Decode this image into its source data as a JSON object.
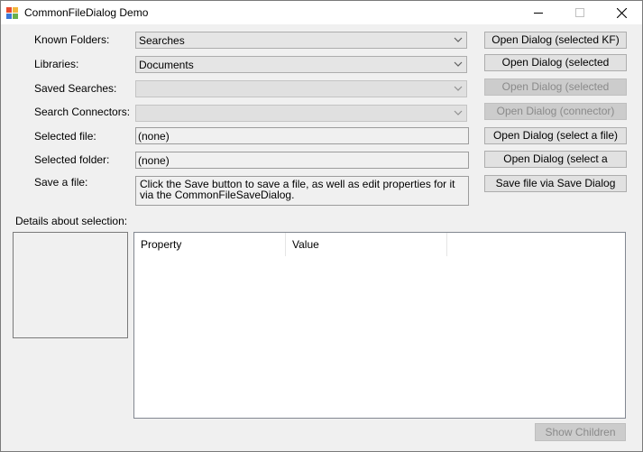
{
  "window": {
    "title": "CommonFileDialog Demo",
    "icon": "app-icon",
    "controls": [
      "minimize-icon",
      "maximize-icon",
      "close-icon"
    ]
  },
  "form": {
    "known_folders": {
      "label": "Known Folders:",
      "value": "Searches"
    },
    "libraries": {
      "label": "Libraries:",
      "value": "Documents"
    },
    "saved_searches": {
      "label": "Saved Searches:",
      "value": ""
    },
    "search_connectors": {
      "label": "Search Connectors:",
      "value": ""
    },
    "selected_file": {
      "label": "Selected file:",
      "value": "(none)"
    },
    "selected_folder": {
      "label": "Selected folder:",
      "value": "(none)"
    },
    "save_file": {
      "label": "Save a file:",
      "value": "Click the Save button to save a file, as well as edit properties for it via the CommonFileSaveDialog."
    }
  },
  "buttons": {
    "open_kf": "Open Dialog (selected KF)",
    "open_library": "Open Dialog (selected",
    "open_saved_search": "Open Dialog (selected",
    "open_connector": "Open Dialog (connector)",
    "open_file": "Open Dialog (select a file)",
    "open_folder": "Open Dialog (select a",
    "save_file": "Save file via Save Dialog",
    "show_children": "Show Children"
  },
  "details": {
    "label": "Details about selection:",
    "columns": [
      "Property",
      "Value"
    ]
  }
}
